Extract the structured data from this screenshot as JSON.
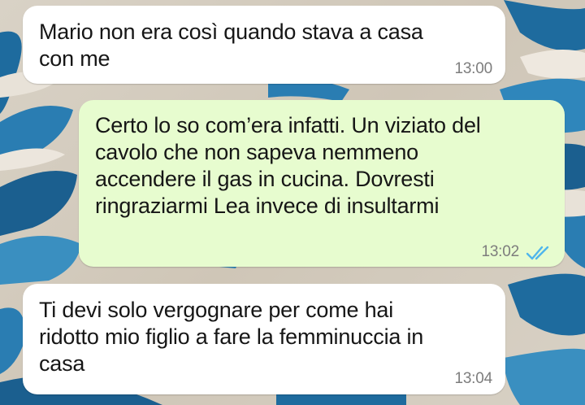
{
  "chat": {
    "messages": [
      {
        "direction": "incoming",
        "text": "Mario non era così quando stava a casa\ncon me",
        "time": "13:00"
      },
      {
        "direction": "outgoing",
        "text": "Certo lo so com’era infatti. Un viziato del\ncavolo che non sapeva nemmeno\naccendere il gas in cucina. Dovresti\nringraziarmi Lea invece di insultarmi",
        "time": "13:02",
        "status_icon": "double-check-read-icon",
        "status_color": "#4fb6ec"
      },
      {
        "direction": "incoming",
        "text": "Ti devi solo vergognare per come hai\nridotto mio figlio a fare la femminuccia in\ncasa",
        "time": "13:04"
      }
    ]
  },
  "colors": {
    "incoming_bubble": "#ffffff",
    "outgoing_bubble": "#e7fccf",
    "wallpaper_blue": "#1f6fa3",
    "wallpaper_sand": "#d9d2c6"
  }
}
